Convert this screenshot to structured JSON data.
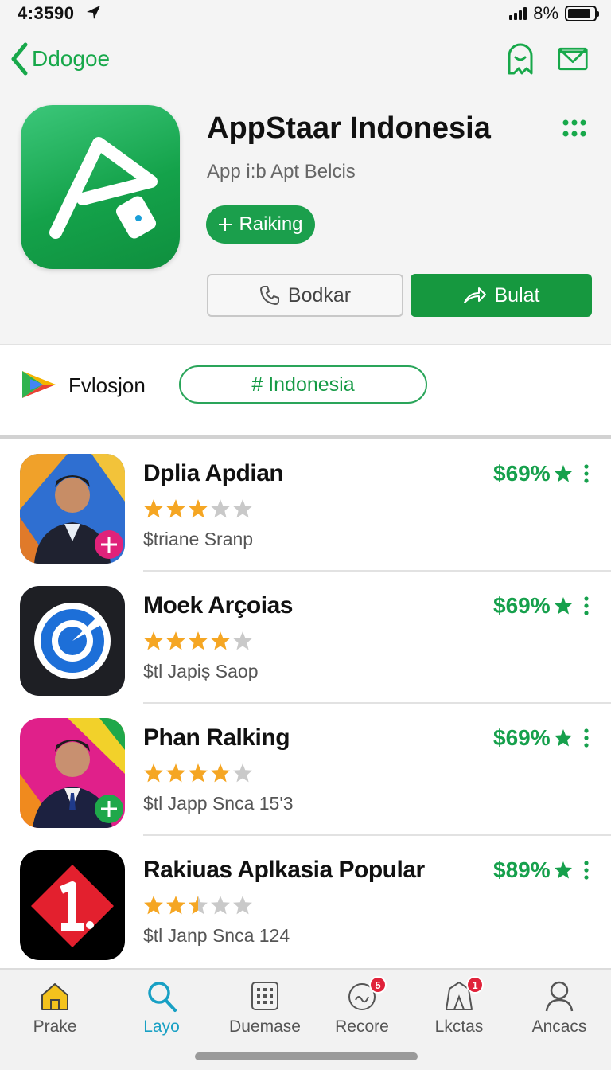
{
  "status_bar": {
    "time": "4:3590",
    "battery_percent": "8%"
  },
  "nav": {
    "back_label": "Ddogoe"
  },
  "app": {
    "title": "AppStaar Indonesia",
    "subtitle": "App i:b Apt Belcis",
    "ranking_label": "Raiking",
    "button_secondary": "Bodkar",
    "button_primary": "Bulat"
  },
  "filter": {
    "label": "Fvlosjon",
    "tag": "# Indonesia"
  },
  "apps": [
    {
      "name": "Dplia Apdian",
      "rating": 3,
      "sub": "$triane Sranp",
      "price": "$69%"
    },
    {
      "name": "Moek Arçoias",
      "rating": 4,
      "sub": "$tl Japiș Saop",
      "price": "$69%"
    },
    {
      "name": "Phan Ralking",
      "rating": 4,
      "sub": "$tl Japp Snca 15'3",
      "price": "$69%"
    },
    {
      "name": "Rakiuas Aplkasia Popular",
      "rating": 2.5,
      "sub": "$tl Janp Snca 124",
      "price": "$89%"
    }
  ],
  "tabs": [
    {
      "label": "Prake",
      "icon": "home-icon"
    },
    {
      "label": "Layo",
      "icon": "search-icon"
    },
    {
      "label": "Duemase",
      "icon": "grid-icon"
    },
    {
      "label": "Recore",
      "icon": "recent-icon",
      "badge": "5"
    },
    {
      "label": "Lkctas",
      "icon": "tent-icon",
      "badge": "1"
    },
    {
      "label": "Ancacs",
      "icon": "person-icon"
    }
  ],
  "colors": {
    "accent_green": "#17a84a",
    "primary_button": "#16983f",
    "active_tab": "#18a0c4",
    "star": "#f5a623",
    "badge": "#e0223a"
  }
}
